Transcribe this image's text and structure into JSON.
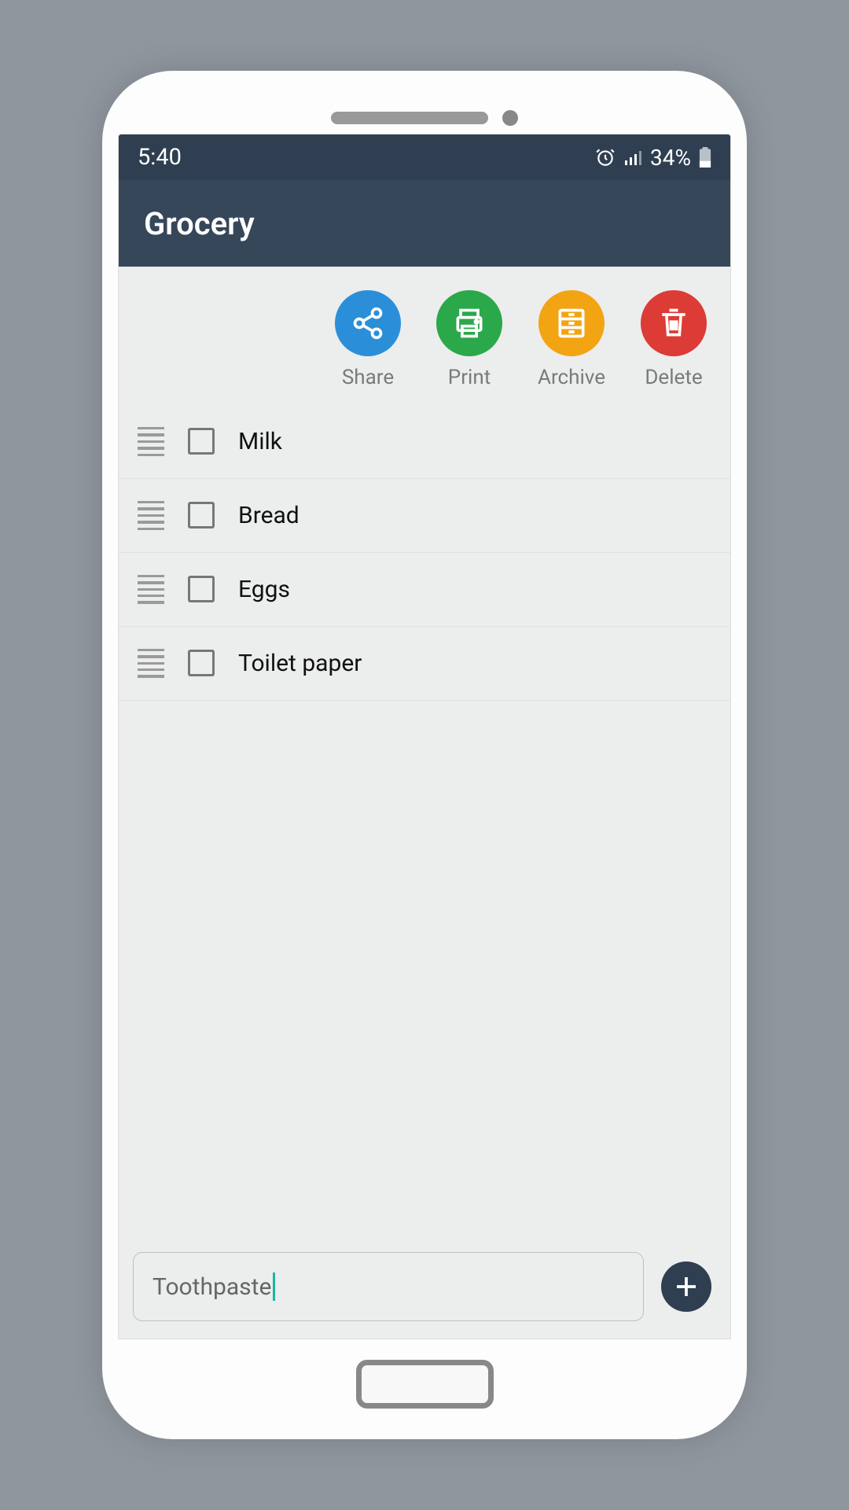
{
  "status": {
    "time": "5:40",
    "battery": "34%"
  },
  "header": {
    "title": "Grocery"
  },
  "actions": {
    "share": "Share",
    "print": "Print",
    "archive": "Archive",
    "delete": "Delete"
  },
  "colors": {
    "share": "#2a8fd8",
    "print": "#2aa84a",
    "archive": "#f2a412",
    "delete": "#dc3b36"
  },
  "items": [
    {
      "label": "Milk",
      "checked": false
    },
    {
      "label": "Bread",
      "checked": false
    },
    {
      "label": "Eggs",
      "checked": false
    },
    {
      "label": "Toilet paper",
      "checked": false
    }
  ],
  "input": {
    "value": "Toothpaste"
  }
}
